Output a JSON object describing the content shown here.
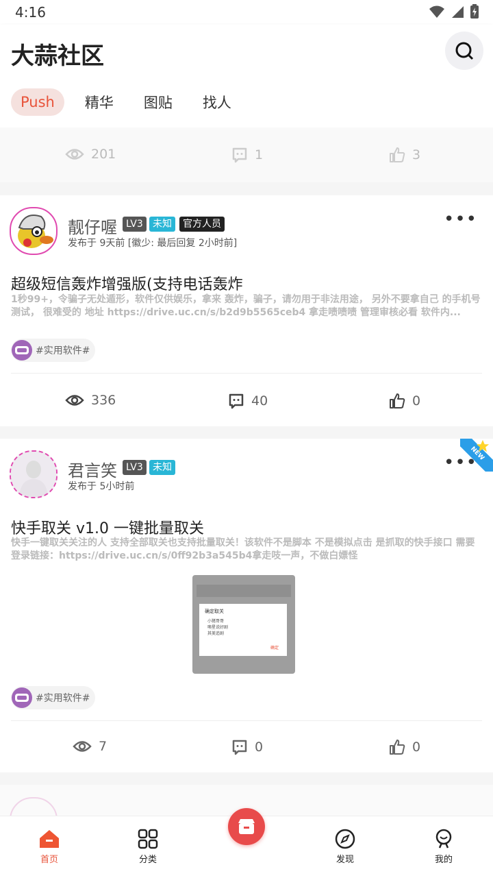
{
  "status_bar": {
    "time": "4:16"
  },
  "header": {
    "title": "大蒜社区",
    "tabs": [
      {
        "label": "Push",
        "active": true
      },
      {
        "label": "精华"
      },
      {
        "label": "图贴"
      },
      {
        "label": "找人"
      }
    ]
  },
  "partial_card": {
    "views": "201",
    "comments": "1",
    "likes": "3"
  },
  "posts": [
    {
      "username": "靓仔喔",
      "level": "LV3",
      "badge_status": "未知",
      "badge_official": "官方人员",
      "meta": "发布于 9天前 [徽少: 最后回复 2小时前]",
      "title": "超级短信轰炸增强版(支持电话轰炸",
      "body": "1秒99+，令骗子无处遁形，软件仅供娱乐，拿来 轰炸，骗子，请勿用于非法用途， 另外不要拿自己 的手机号测试， 很难受的 地址 https://drive.uc.cn/s/b2d9b5565ceb4 拿走啧啧啧 管理审核必看 软件内...",
      "tag": "#实用软件#",
      "views": "336",
      "comments": "40",
      "likes": "0"
    },
    {
      "username": "君言笑",
      "level": "LV3",
      "badge_status": "未知",
      "meta": "发布于 5小时前",
      "title": "快手取关 v1.0 一键批量取关",
      "body": "快手一键取关关注的人 支持全部取关也支持批量取关！该软件不是脚本 不是模拟点击 是抓取的快手接口 需要登录链接：https://drive.uc.cn/s/0ff92b3a545b4拿走吱一声，不做白嫖怪",
      "image_dialog": {
        "title": "确定取关",
        "lines": [
          "小猪哥哥",
          "噢星说好剧",
          "其美追剧"
        ],
        "button": "确定"
      },
      "new_badge": "NEW",
      "tag": "#实用软件#",
      "views": "7",
      "comments": "0",
      "likes": "0"
    }
  ],
  "bottom_nav": [
    {
      "label": "首页",
      "active": true
    },
    {
      "label": "分类"
    },
    {
      "label": "发现"
    },
    {
      "label": "我的"
    }
  ],
  "colors": {
    "accent": "#e8533a",
    "tab_active_bg": "#f5e1de",
    "level_badge": "#555555",
    "status_badge": "#29b6d6",
    "official_badge": "#222222"
  }
}
